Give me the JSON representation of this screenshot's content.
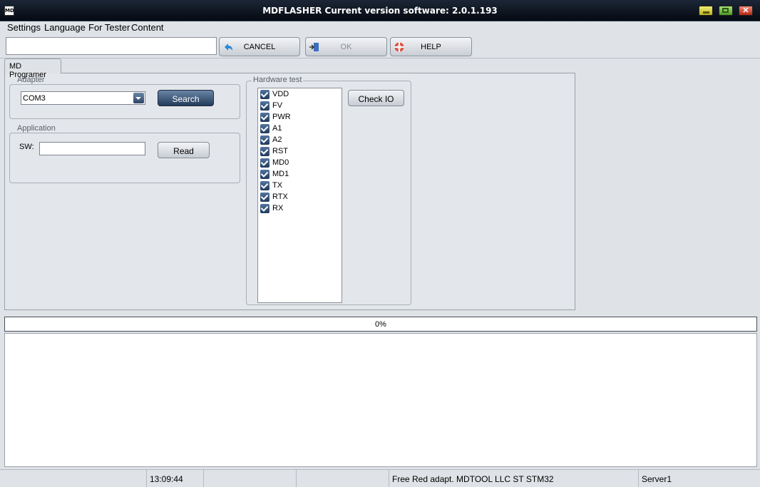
{
  "window": {
    "title": "MDFLASHER  Current version software: 2.0.1.193",
    "icon_text": "MD"
  },
  "menu": [
    {
      "label": "Settings"
    },
    {
      "label": "Language"
    },
    {
      "label": "For Tester"
    },
    {
      "label": "Content"
    }
  ],
  "toolbar": {
    "input_value": "",
    "cancel_label": "CANCEL",
    "ok_label": "OK",
    "help_label": "HELP"
  },
  "tabs": [
    {
      "label": "MD Programer",
      "active": true
    }
  ],
  "adapter": {
    "title": "Adapter",
    "port": "COM3",
    "search_label": "Search"
  },
  "application": {
    "title": "Application",
    "sw_label": "SW:",
    "sw_value": "",
    "read_label": "Read"
  },
  "hardware_test": {
    "title": "Hardware test",
    "check_label": "Check IO",
    "items": [
      {
        "label": "VDD",
        "checked": true
      },
      {
        "label": "FV",
        "checked": true
      },
      {
        "label": "PWR",
        "checked": true
      },
      {
        "label": "A1",
        "checked": true
      },
      {
        "label": "A2",
        "checked": true
      },
      {
        "label": "RST",
        "checked": true
      },
      {
        "label": "MD0",
        "checked": true
      },
      {
        "label": "MD1",
        "checked": true
      },
      {
        "label": "TX",
        "checked": true
      },
      {
        "label": "RTX",
        "checked": true
      },
      {
        "label": "RX",
        "checked": true
      }
    ]
  },
  "progress": {
    "value": 0,
    "text": "0%"
  },
  "status": {
    "cells": [
      "",
      "13:09:44",
      "",
      "",
      "Free Red adapt. MDTOOL LLC ST STM32",
      "Server1"
    ]
  },
  "colors": {
    "title_bar": "#0b121d",
    "search_button": "#3a5676",
    "checkbox": "#2e4a70"
  }
}
